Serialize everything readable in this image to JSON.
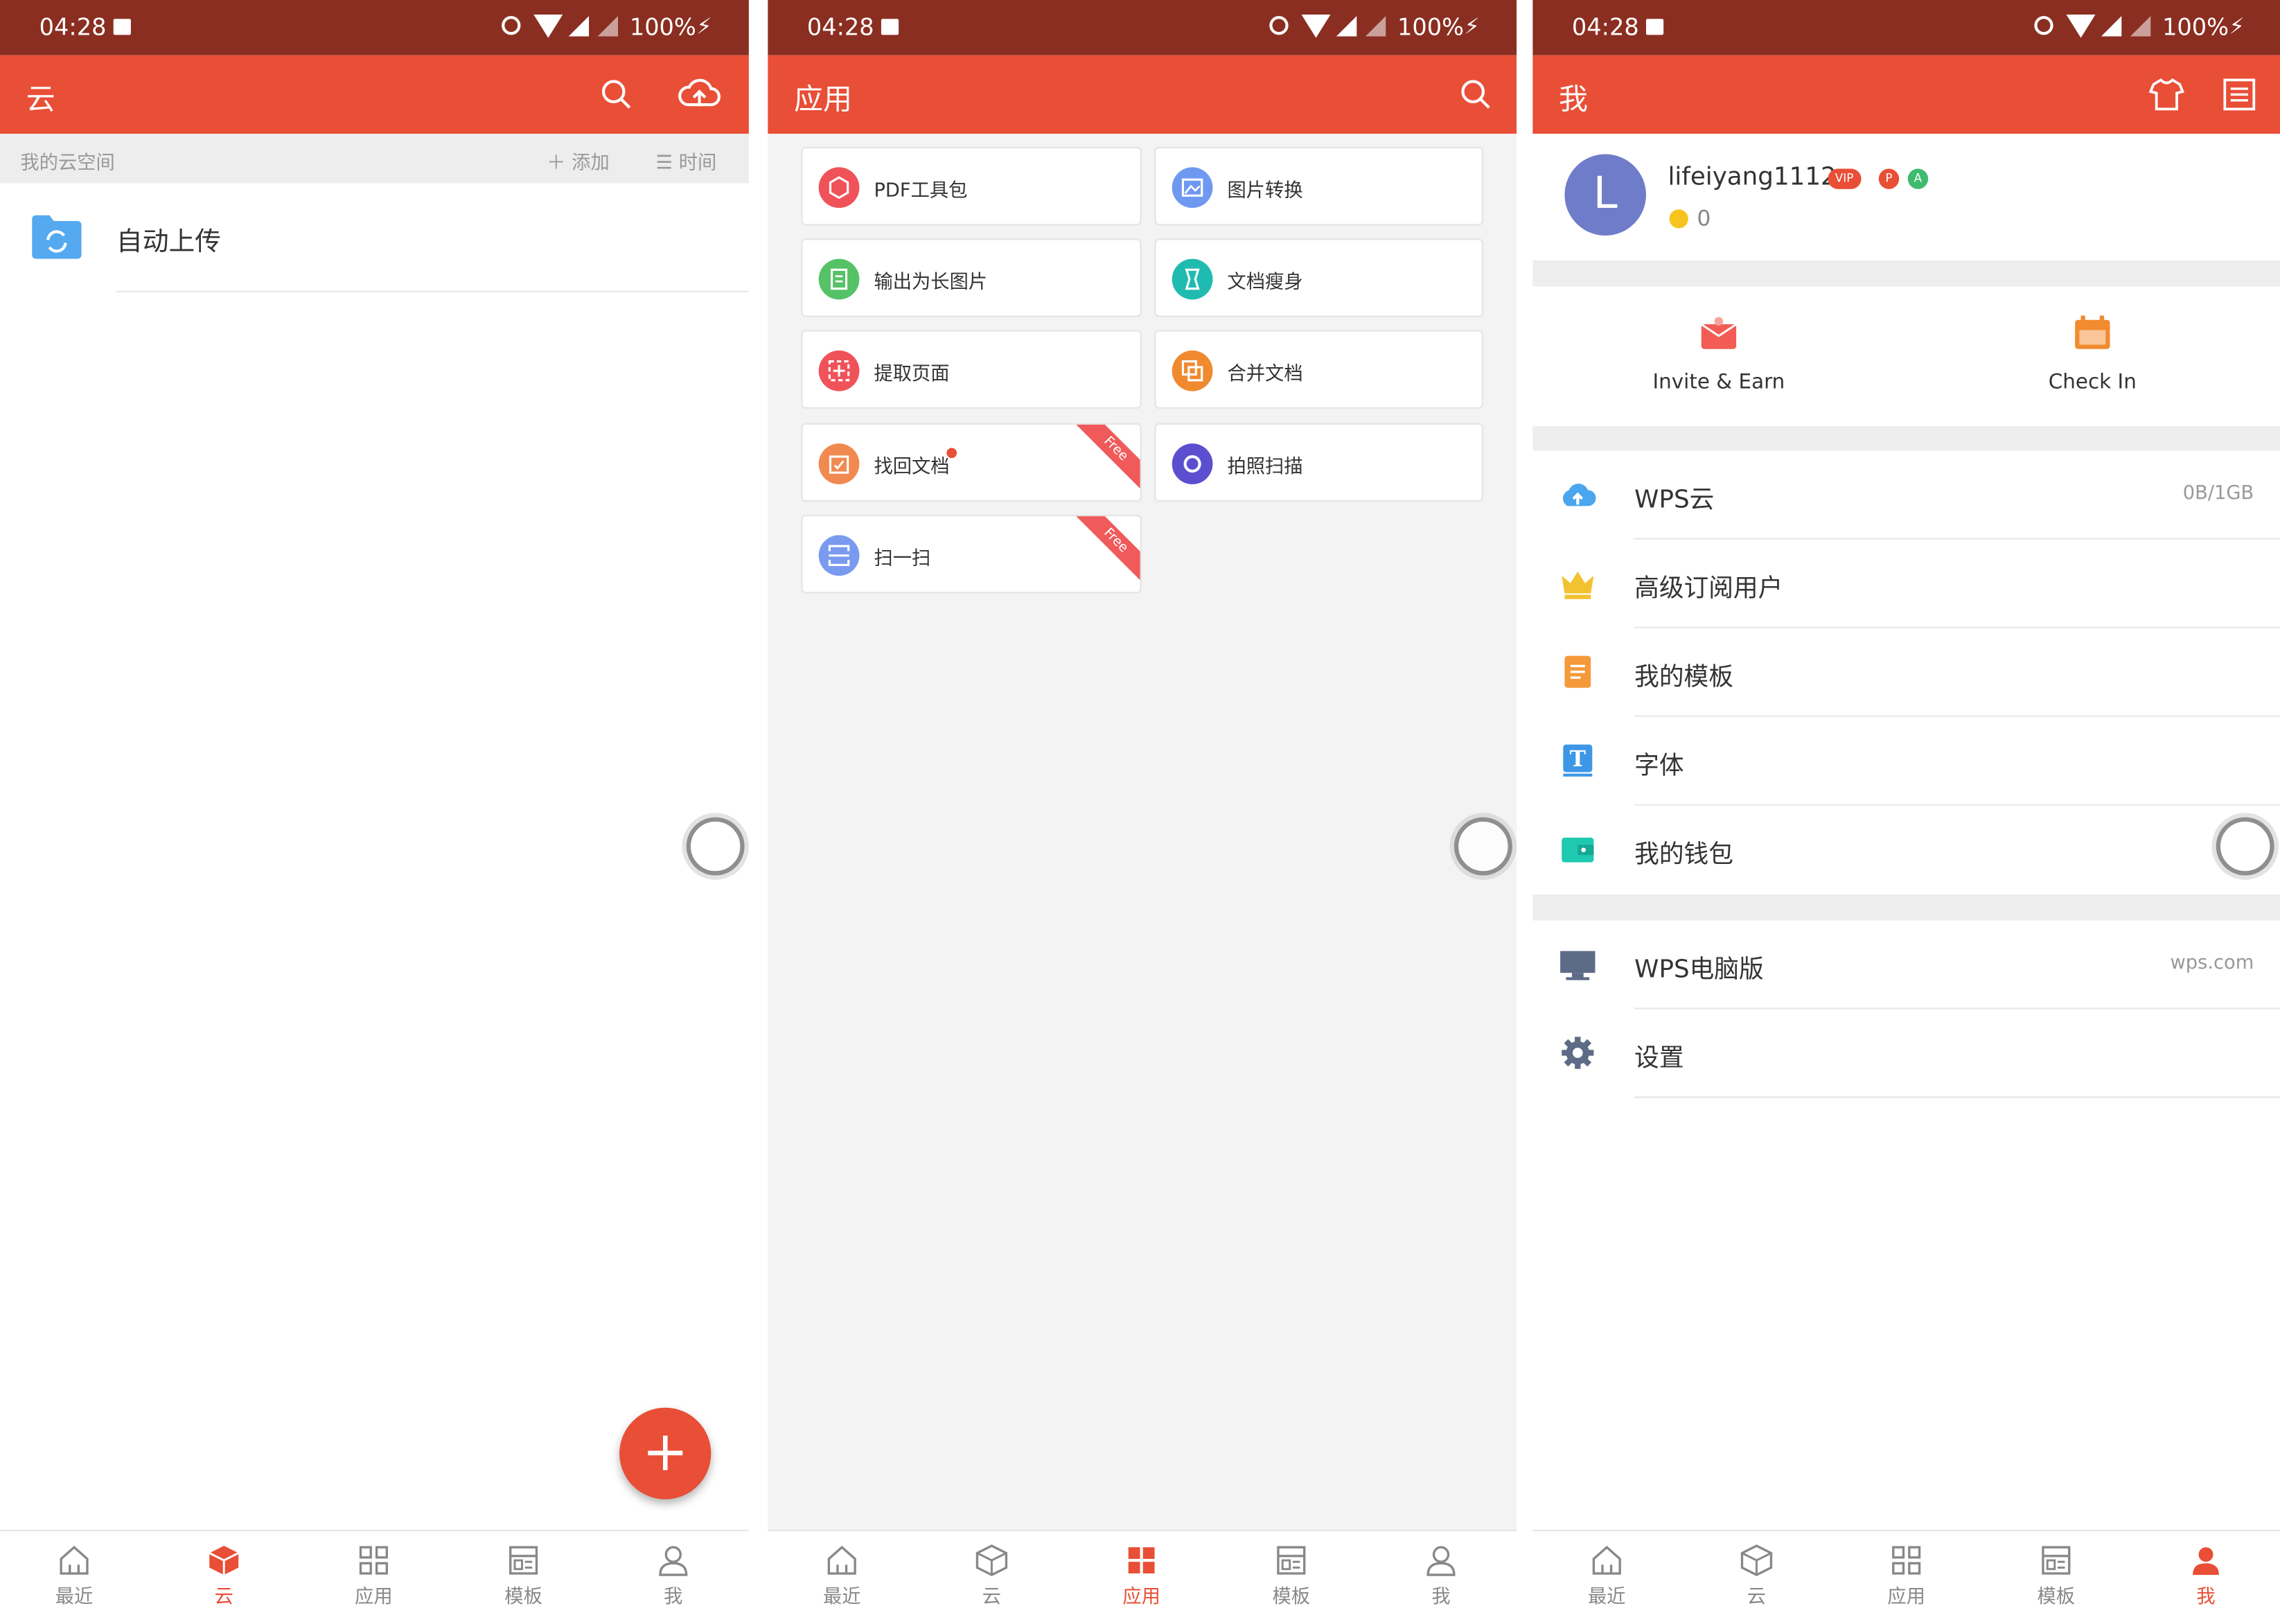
{
  "status_bar": {
    "time": "04:28",
    "battery": "100%"
  },
  "colors": {
    "accent": "#e94e36",
    "status": "#8a2e21"
  },
  "nav": {
    "recent": "最近",
    "cloud": "云",
    "apps": "应用",
    "templates": "模板",
    "me": "我"
  },
  "cloud_screen": {
    "title": "云",
    "space_label": "我的云空间",
    "add_label": "添加",
    "sort_label": "时间",
    "folder_label": "自动上传",
    "fab_label": "+"
  },
  "apps_screen": {
    "title": "应用",
    "ribbon_text": "Free",
    "cards": [
      {
        "label": "PDF工具包",
        "icon": "pdf-icon",
        "color": "#f0525a"
      },
      {
        "label": "图片转换",
        "icon": "image-icon",
        "color": "#6f99f1"
      },
      {
        "label": "输出为长图片",
        "icon": "long-image-icon",
        "color": "#56c267"
      },
      {
        "label": "文档瘦身",
        "icon": "slim-icon",
        "color": "#20bbb0"
      },
      {
        "label": "提取页面",
        "icon": "extract-icon",
        "color": "#f0525a"
      },
      {
        "label": "合并文档",
        "icon": "merge-icon",
        "color": "#f08a30"
      },
      {
        "label": "找回文档",
        "icon": "recover-icon",
        "color": "#f08a50"
      },
      {
        "label": "拍照扫描",
        "icon": "scan-photo-icon",
        "color": "#5b4fd0"
      },
      {
        "label": "扫一扫",
        "icon": "qr-scan-icon",
        "color": "#7a9af0"
      }
    ]
  },
  "me_screen": {
    "title": "我",
    "avatar_letter": "L",
    "username": "lifeiyang1112",
    "vip_badge": "VIP",
    "coins": "0",
    "invite_label": "Invite & Earn",
    "checkin_label": "Check In",
    "rows": [
      {
        "label": "WPS云",
        "right": "0B/1GB",
        "icon": "cloud-upload-icon"
      },
      {
        "label": "高级订阅用户",
        "right": "",
        "icon": "crown-icon"
      },
      {
        "label": "我的模板",
        "right": "",
        "icon": "template-icon"
      },
      {
        "label": "字体",
        "right": "",
        "icon": "font-icon"
      },
      {
        "label": "我的钱包",
        "right": "",
        "icon": "wallet-icon"
      }
    ],
    "rows2": [
      {
        "label": "WPS电脑版",
        "right": "wps.com",
        "icon": "monitor-icon"
      },
      {
        "label": "设置",
        "right": "",
        "icon": "settings-icon"
      }
    ]
  }
}
